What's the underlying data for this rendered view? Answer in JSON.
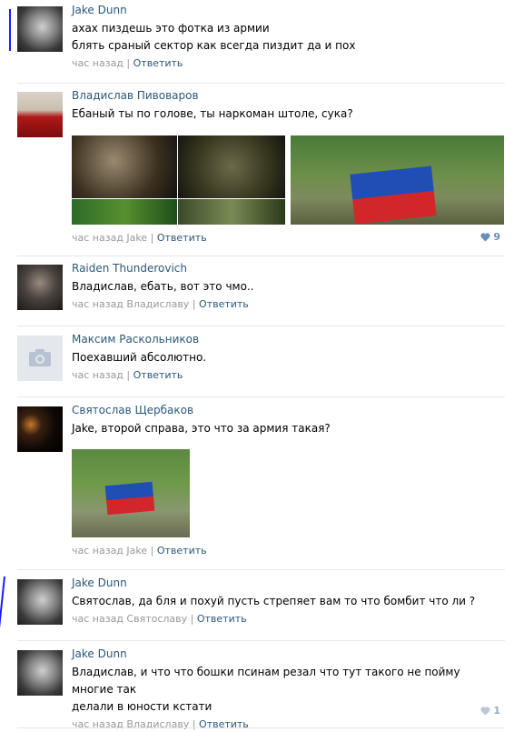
{
  "colors": {
    "link": "#2b587a",
    "meta": "#999999",
    "separator": "#e7e8ec",
    "like": "#6a8fb3"
  },
  "comments": [
    {
      "author": "Jake Dunn",
      "lines": [
        "ахах пиздешь это фотка из армии",
        "блять сраный сектор как всегда пиздит да и пох"
      ],
      "time": "час назад",
      "reply_to": "",
      "reply_label": "Ответить",
      "avatar_icon": "user-avatar-photo"
    },
    {
      "author": "Владислав Пивоваров",
      "lines": [
        "Ебаный ты по голове, ты наркоман штоле, сука?"
      ],
      "time": "час назад",
      "reply_to": "Jake",
      "reply_label": "Ответить",
      "likes": "9",
      "avatar_icon": "user-avatar-photo"
    },
    {
      "author": "Raiden Thunderovich",
      "lines": [
        "Владислав, ебать, вот это чмо.."
      ],
      "time": "час назад",
      "reply_to": "Владиславу",
      "reply_label": "Ответить",
      "avatar_icon": "user-avatar-photo"
    },
    {
      "author": "Максим Раскольников",
      "lines": [
        "Поехавший абсолютно."
      ],
      "time": "час назад",
      "reply_to": "",
      "reply_label": "Ответить",
      "avatar_icon": "camera-icon"
    },
    {
      "author": "Святослав Щербаков",
      "lines": [
        "Jake, второй справа, это что за армия такая?"
      ],
      "time": "час назад",
      "reply_to": "Jake",
      "reply_label": "Ответить",
      "avatar_icon": "user-avatar-photo"
    },
    {
      "author": "Jake Dunn",
      "lines": [
        "Святослав, да бля и похуй пусть стрепяет вам то что бомбит что ли ?"
      ],
      "time": "час назад",
      "reply_to": "Святославу",
      "reply_label": "Ответить",
      "avatar_icon": "user-avatar-photo"
    },
    {
      "author": "Jake Dunn",
      "lines": [
        "Владислав, и что что бошки псинам резал что тут такого не пойму многие так",
        "делали в юности кстати"
      ],
      "time": "час назад",
      "reply_to": "Владиславу",
      "reply_label": "Ответить",
      "likes": "1",
      "avatar_icon": "user-avatar-photo"
    }
  ],
  "separator": " | "
}
